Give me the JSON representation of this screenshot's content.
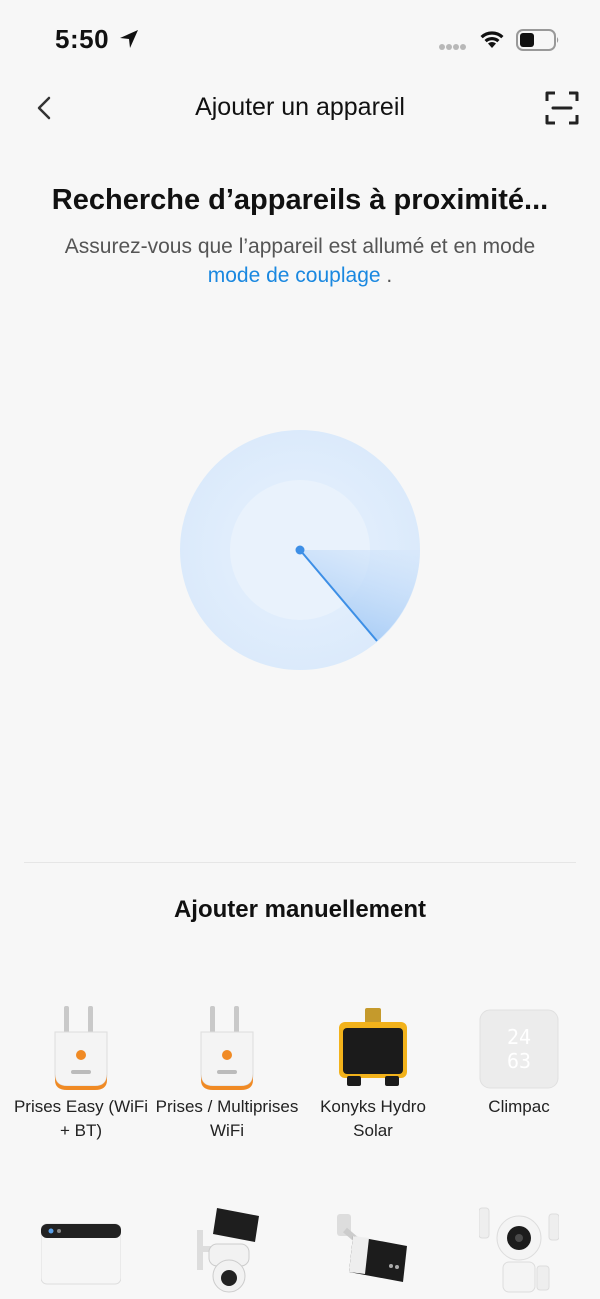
{
  "status_bar": {
    "time": "5:50",
    "icons": [
      "location-arrow-icon",
      "cellular-signal-icon",
      "wifi-icon",
      "battery-icon"
    ]
  },
  "nav": {
    "title": "Ajouter un appareil",
    "back_icon": "chevron-left-icon",
    "scan_icon": "scan-frame-icon"
  },
  "search": {
    "title": "Recherche d’appareils à proximité...",
    "description_prefix": "Assurez-vous que l’appareil est allumé et en mode ",
    "pairing_link": "mode de couplage",
    "description_suffix": " ."
  },
  "manual": {
    "title": "Ajouter manuellement",
    "devices": [
      {
        "label": "Prises Easy (WiFi + BT)",
        "icon": "smart-plug-icon"
      },
      {
        "label": "Prises / Multiprises WiFi",
        "icon": "smart-plug-icon"
      },
      {
        "label": "Konyks Hydro Solar",
        "icon": "water-valve-icon"
      },
      {
        "label": "Climpac",
        "icon": "thermostat-display-icon"
      },
      {
        "label": "",
        "icon": "hub-gateway-icon"
      },
      {
        "label": "",
        "icon": "solar-camera-icon"
      },
      {
        "label": "",
        "icon": "bullet-camera-icon"
      },
      {
        "label": "",
        "icon": "security-kit-icon"
      }
    ]
  },
  "colors": {
    "background": "#f7f7f7",
    "link": "#1a88e0",
    "radar": "#cfe3fa",
    "plug_accent": "#f08a24",
    "valve_accent": "#f2b21b"
  }
}
